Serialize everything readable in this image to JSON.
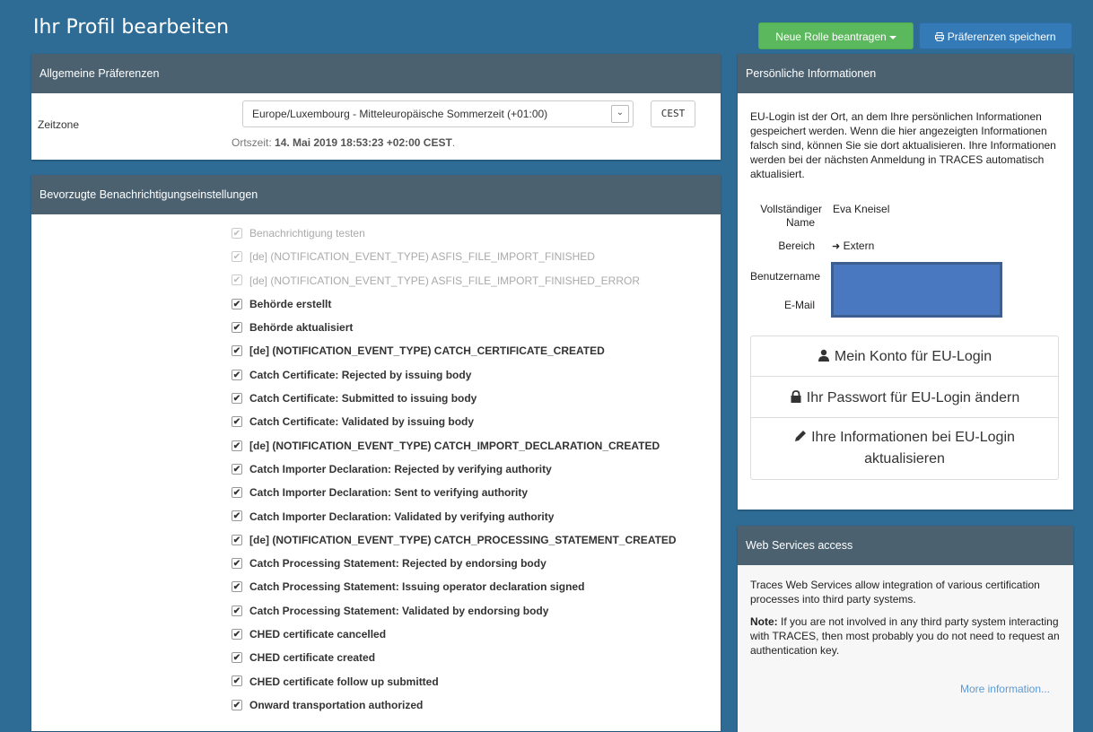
{
  "page": {
    "title": "Ihr Profil bearbeiten",
    "new_role_button": "Neue Rolle beantragen",
    "save_button": "Präferenzen speichern"
  },
  "general": {
    "header": "Allgemeine Präferenzen",
    "timezone_label": "Zeitzone",
    "timezone_value": "Europe/Luxembourg - Mitteleuropäische Sommerzeit (+01:00)",
    "timezone_code": "CEST",
    "local_time_prefix": "Ortszeit:",
    "local_time_value": "14. Mai 2019 18:53:23 +02:00 CEST",
    "local_time_suffix": "."
  },
  "notifications": {
    "header": "Bevorzugte Benachrichtigungseinstellungen",
    "items": [
      {
        "label": "Benachrichtigung testen",
        "enabled": false,
        "checked": true
      },
      {
        "label": "[de] (NOTIFICATION_EVENT_TYPE) ASFIS_FILE_IMPORT_FINISHED",
        "enabled": false,
        "checked": true
      },
      {
        "label": "[de] (NOTIFICATION_EVENT_TYPE) ASFIS_FILE_IMPORT_FINISHED_ERROR",
        "enabled": false,
        "checked": true
      },
      {
        "label": "Behörde erstellt",
        "enabled": true,
        "checked": true
      },
      {
        "label": "Behörde aktualisiert",
        "enabled": true,
        "checked": true
      },
      {
        "label": "[de] (NOTIFICATION_EVENT_TYPE) CATCH_CERTIFICATE_CREATED",
        "enabled": true,
        "checked": true
      },
      {
        "label": "Catch Certificate: Rejected by issuing body",
        "enabled": true,
        "checked": true
      },
      {
        "label": "Catch Certificate: Submitted to issuing body",
        "enabled": true,
        "checked": true
      },
      {
        "label": "Catch Certificate: Validated by issuing body",
        "enabled": true,
        "checked": true
      },
      {
        "label": "[de] (NOTIFICATION_EVENT_TYPE) CATCH_IMPORT_DECLARATION_CREATED",
        "enabled": true,
        "checked": true
      },
      {
        "label": "Catch Importer Declaration: Rejected by verifying authority",
        "enabled": true,
        "checked": true
      },
      {
        "label": "Catch Importer Declaration: Sent to verifying authority",
        "enabled": true,
        "checked": true
      },
      {
        "label": "Catch Importer Declaration: Validated by verifying authority",
        "enabled": true,
        "checked": true
      },
      {
        "label": "[de] (NOTIFICATION_EVENT_TYPE) CATCH_PROCESSING_STATEMENT_CREATED",
        "enabled": true,
        "checked": true
      },
      {
        "label": "Catch Processing Statement: Rejected by endorsing body",
        "enabled": true,
        "checked": true
      },
      {
        "label": "Catch Processing Statement: Issuing operator declaration signed",
        "enabled": true,
        "checked": true
      },
      {
        "label": "Catch Processing Statement: Validated by endorsing body",
        "enabled": true,
        "checked": true
      },
      {
        "label": "CHED certificate cancelled",
        "enabled": true,
        "checked": true
      },
      {
        "label": "CHED certificate created",
        "enabled": true,
        "checked": true
      },
      {
        "label": "CHED certificate follow up submitted",
        "enabled": true,
        "checked": true
      },
      {
        "label": "Onward transportation authorized",
        "enabled": true,
        "checked": true
      }
    ]
  },
  "personal": {
    "header": "Persönliche Informationen",
    "intro": "EU-Login ist der Ort, an dem Ihre persönlichen Informationen gespeichert werden. Wenn die hier angezeigten Informationen falsch sind, können Sie sie dort aktualisieren. Ihre Informationen werden bei der nächsten Anmeldung in TRACES automatisch aktualisiert.",
    "full_name_label_1": "Vollständiger",
    "full_name_label_2": "Name",
    "full_name_value": "Eva Kneisel",
    "scope_label": "Bereich",
    "scope_value": "Extern",
    "username_label": "Benutzername",
    "email_label": "E-Mail",
    "account_button": "Mein Konto für EU-Login",
    "password_button": "Ihr Passwort für EU-Login ändern",
    "update_button_line1": "Ihre Informationen bei EU-Login",
    "update_button_line2": "aktualisieren"
  },
  "webservices": {
    "header": "Web Services access",
    "text": "Traces Web Services allow integration of various certification processes into third party systems.",
    "note_label": "Note:",
    "note_text": " If you are not involved in any third party system interacting with TRACES, then most probably you do not need to request an authentication key.",
    "more_link": "More information..."
  }
}
